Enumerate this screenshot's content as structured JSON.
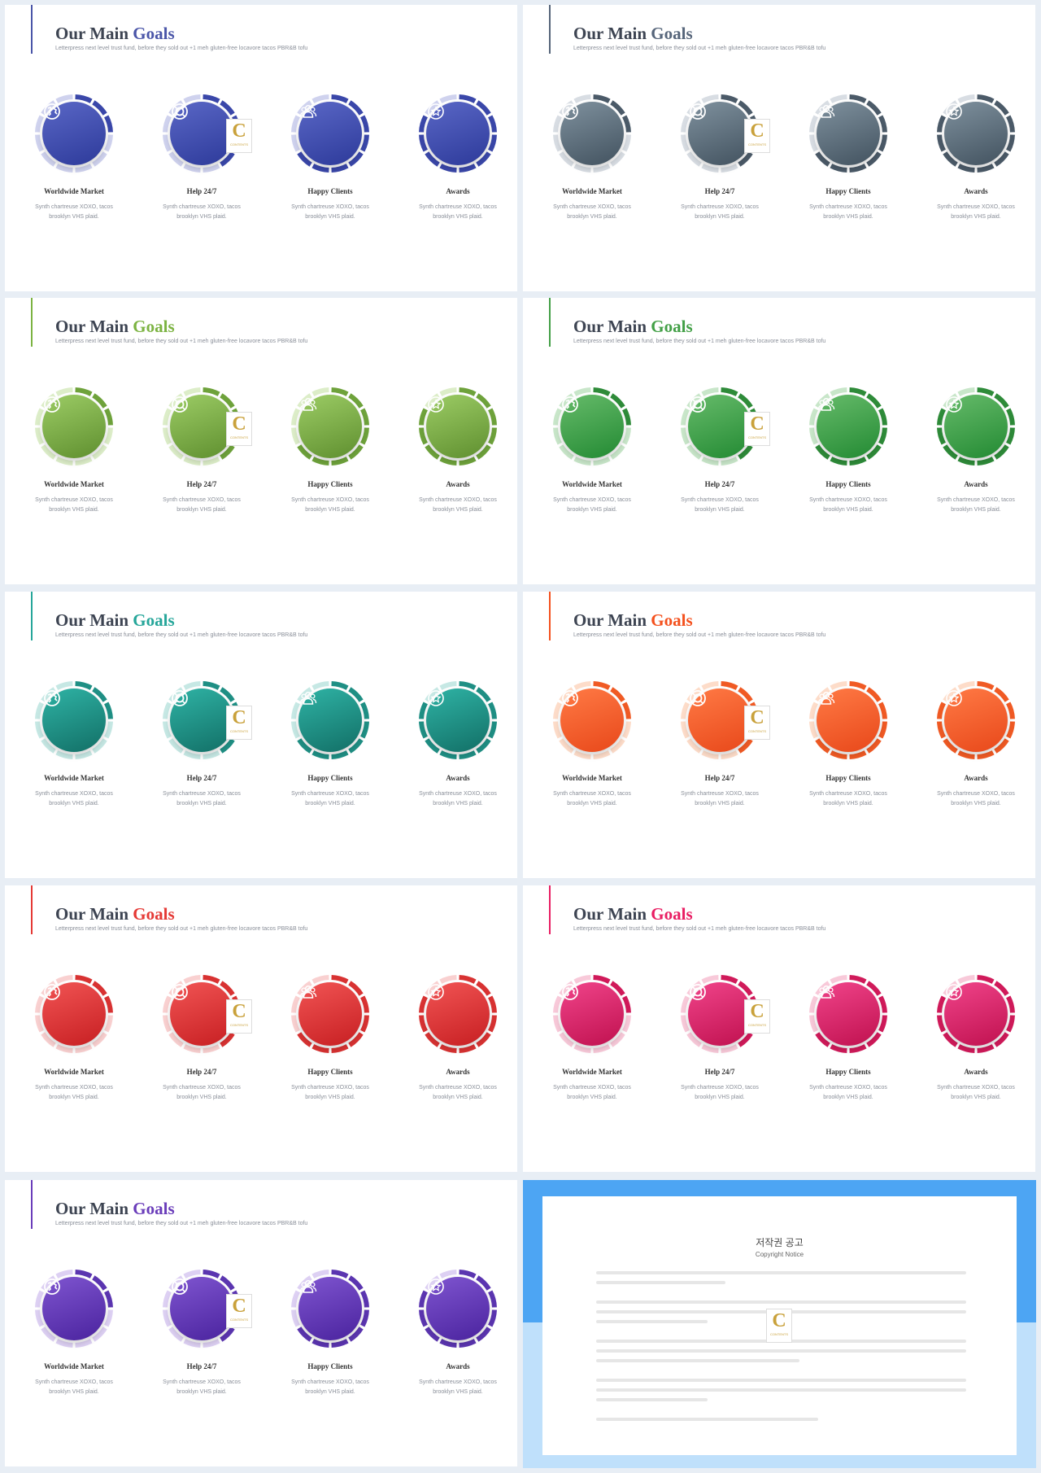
{
  "slides": [
    {
      "title_main": "Our Main",
      "title_accent": "Goals",
      "accent": "#4a55a8",
      "subtitle": "Letterpress next level trust fund, before they sold out +1 meh gluten-free locavore tacos PBR&B tofu",
      "ring_light": "#cfd2ee",
      "ring_dark": "#3a47a9",
      "inner_light": "#5a67c6",
      "inner_dark": "#2d3a9a"
    },
    {
      "title_main": "Our Main",
      "title_accent": "Goals",
      "accent": "#56657a",
      "subtitle": "Letterpress next level trust fund, before they sold out +1 meh gluten-free locavore tacos PBR&B tofu",
      "ring_light": "#d8dde3",
      "ring_dark": "#4b5a68",
      "inner_light": "#7f919e",
      "inner_dark": "#42525f"
    },
    {
      "title_main": "Our Main",
      "title_accent": "Goals",
      "accent": "#7cb342",
      "subtitle": "Letterpress next level trust fund, before they sold out +1 meh gluten-free locavore tacos PBR&B tofu",
      "ring_light": "#dcedc8",
      "ring_dark": "#6ea23b",
      "inner_light": "#9ccc65",
      "inner_dark": "#5f8f2f"
    },
    {
      "title_main": "Our Main",
      "title_accent": "Goals",
      "accent": "#43a047",
      "subtitle": "Letterpress next level trust fund, before they sold out +1 meh gluten-free locavore tacos PBR&B tofu",
      "ring_light": "#c8e6c9",
      "ring_dark": "#2e8b39",
      "inner_light": "#66bb6a",
      "inner_dark": "#238a33"
    },
    {
      "title_main": "Our Main",
      "title_accent": "Goals",
      "accent": "#26a69a",
      "subtitle": "Letterpress next level trust fund, before they sold out +1 meh gluten-free locavore tacos PBR&B tofu",
      "ring_light": "#c6e8e4",
      "ring_dark": "#1f8f84",
      "inner_light": "#2fb3a5",
      "inner_dark": "#126f66"
    },
    {
      "title_main": "Our Main",
      "title_accent": "Goals",
      "accent": "#f4511e",
      "subtitle": "Letterpress next level trust fund, before they sold out +1 meh gluten-free locavore tacos PBR&B tofu",
      "ring_light": "#fddcc9",
      "ring_dark": "#f05a24",
      "inner_light": "#ff7a45",
      "inner_dark": "#e8481a"
    },
    {
      "title_main": "Our Main",
      "title_accent": "Goals",
      "accent": "#e53935",
      "subtitle": "Letterpress next level trust fund, before they sold out +1 meh gluten-free locavore tacos PBR&B tofu",
      "ring_light": "#f9d0d0",
      "ring_dark": "#d83232",
      "inner_light": "#f15454",
      "inner_dark": "#c71f22"
    },
    {
      "title_main": "Our Main",
      "title_accent": "Goals",
      "accent": "#e91e63",
      "subtitle": "Letterpress next level trust fund, before they sold out +1 meh gluten-free locavore tacos PBR&B tofu",
      "ring_light": "#f8c9d9",
      "ring_dark": "#d01a5a",
      "inner_light": "#f0448a",
      "inner_dark": "#c0114f"
    },
    {
      "title_main": "Our Main",
      "title_accent": "Goals",
      "accent": "#6a3dba",
      "subtitle": "Letterpress next level trust fund, before they sold out +1 meh gluten-free locavore tacos PBR&B tofu",
      "ring_light": "#ddd0f3",
      "ring_dark": "#5b35b0",
      "inner_light": "#7f55d0",
      "inner_dark": "#4a239e"
    }
  ],
  "items": [
    {
      "title": "Worldwide Market",
      "desc1": "Synth chartreuse XOXO, tacos",
      "desc2": "brooklyn VHS plaid.",
      "icon": "globe-icon"
    },
    {
      "title": "Help 24/7",
      "desc1": "Synth chartreuse XOXO, tacos",
      "desc2": "brooklyn VHS plaid.",
      "icon": "lifebuoy-icon"
    },
    {
      "title": "Happy Clients",
      "desc1": "Synth chartreuse XOXO, tacos",
      "desc2": "brooklyn VHS plaid.",
      "icon": "users-icon"
    },
    {
      "title": "Awards",
      "desc1": "Synth chartreuse XOXO, tacos",
      "desc2": "brooklyn VHS plaid.",
      "icon": "star-icon"
    }
  ],
  "logo": {
    "letter": "C",
    "word": "CONTENTS"
  },
  "copyright": {
    "title": "저작권 공고",
    "subtitle": "Copyright Notice",
    "bg_top": "#4da5f3",
    "bg_bottom": "#bfe0fb"
  }
}
